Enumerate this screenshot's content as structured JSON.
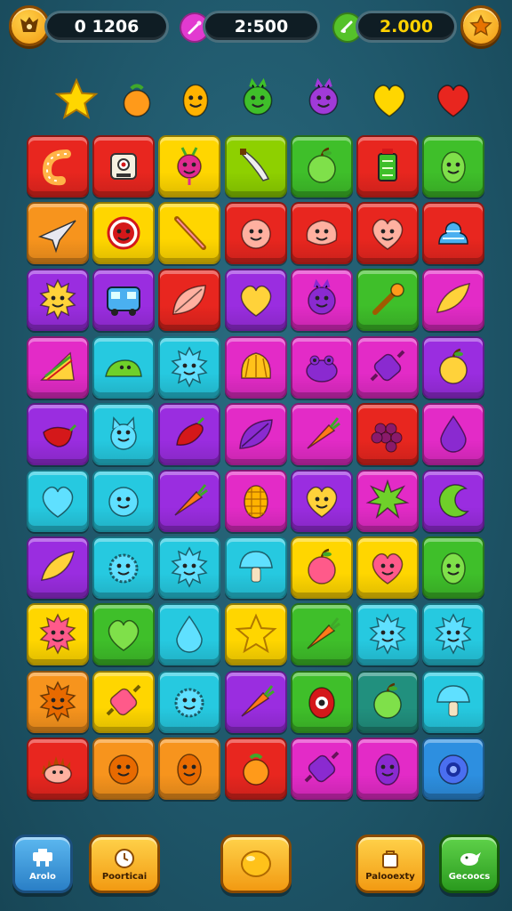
{
  "hud": {
    "left_button_icon": "badge-icon",
    "score": "0 1206",
    "moves": "2:500",
    "gold": "2.000",
    "moves_icon": "magic-wand-icon",
    "gold_icon": "check-icon",
    "right_button_icon": "star-icon"
  },
  "targets": [
    "starfish-icon",
    "orange-fruit-icon",
    "carrot-creature-icon",
    "green-monster-icon",
    "purple-creature-icon",
    "yellow-heart-icon",
    "red-heart-icon"
  ],
  "colors": {
    "red": "#e8261f",
    "orange": "#f7941d",
    "yellow": "#ffd600",
    "lime": "#8ed000",
    "green": "#3fbf2a",
    "purple": "#9a2de0",
    "magenta": "#e32bc7",
    "cyan": "#26c9e0",
    "blue": "#2d8fe0",
    "teal": "#21907e"
  },
  "board": [
    [
      {
        "c": "red",
        "i": "shrimp-icon"
      },
      {
        "c": "red",
        "i": "robot-icon"
      },
      {
        "c": "yellow",
        "i": "radish-icon"
      },
      {
        "c": "lime",
        "i": "knife-icon"
      },
      {
        "c": "green",
        "i": "apple-icon"
      },
      {
        "c": "red",
        "i": "lantern-icon"
      },
      {
        "c": "green",
        "i": "egg-icon"
      }
    ],
    [
      {
        "c": "orange",
        "i": "plane-icon"
      },
      {
        "c": "yellow",
        "i": "face-icon"
      },
      {
        "c": "yellow",
        "i": "stick-icon"
      },
      {
        "c": "red",
        "i": "smile-ball-icon"
      },
      {
        "c": "red",
        "i": "blob-icon"
      },
      {
        "c": "red",
        "i": "heart-face-icon"
      },
      {
        "c": "red",
        "i": "swirl-icon"
      }
    ],
    [
      {
        "c": "purple",
        "i": "sun-icon"
      },
      {
        "c": "purple",
        "i": "bus-icon"
      },
      {
        "c": "red",
        "i": "leaf-icon"
      },
      {
        "c": "purple",
        "i": "heart-icon"
      },
      {
        "c": "magenta",
        "i": "monster-icon"
      },
      {
        "c": "green",
        "i": "wrench-icon"
      },
      {
        "c": "magenta",
        "i": "banana-icon"
      }
    ],
    [
      {
        "c": "magenta",
        "i": "sandwich-icon"
      },
      {
        "c": "cyan",
        "i": "slug-icon"
      },
      {
        "c": "cyan",
        "i": "sun-icon"
      },
      {
        "c": "magenta",
        "i": "shell-icon"
      },
      {
        "c": "magenta",
        "i": "frog-icon"
      },
      {
        "c": "magenta",
        "i": "candy-icon"
      },
      {
        "c": "purple",
        "i": "apple-icon"
      }
    ],
    [
      {
        "c": "purple",
        "i": "chili-icon"
      },
      {
        "c": "cyan",
        "i": "cat-icon"
      },
      {
        "c": "purple",
        "i": "pepper-icon"
      },
      {
        "c": "magenta",
        "i": "leaf-icon"
      },
      {
        "c": "magenta",
        "i": "carrot-icon"
      },
      {
        "c": "red",
        "i": "grapes-icon"
      },
      {
        "c": "magenta",
        "i": "drop-icon"
      }
    ],
    [
      {
        "c": "cyan",
        "i": "heart-icon"
      },
      {
        "c": "cyan",
        "i": "smile-ball-icon"
      },
      {
        "c": "purple",
        "i": "carrot-icon"
      },
      {
        "c": "magenta",
        "i": "corn-icon"
      },
      {
        "c": "purple",
        "i": "heart-face-icon"
      },
      {
        "c": "magenta",
        "i": "splat-icon"
      },
      {
        "c": "purple",
        "i": "crescent-icon"
      }
    ],
    [
      {
        "c": "purple",
        "i": "banana-icon"
      },
      {
        "c": "cyan",
        "i": "fuzzy-icon"
      },
      {
        "c": "cyan",
        "i": "sun-icon"
      },
      {
        "c": "cyan",
        "i": "mushroom-icon"
      },
      {
        "c": "yellow",
        "i": "apple-icon"
      },
      {
        "c": "yellow",
        "i": "heart-face-icon"
      },
      {
        "c": "green",
        "i": "egg-icon"
      }
    ],
    [
      {
        "c": "yellow",
        "i": "sun-icon"
      },
      {
        "c": "green",
        "i": "heart-icon"
      },
      {
        "c": "cyan",
        "i": "drop-icon"
      },
      {
        "c": "yellow",
        "i": "star-icon"
      },
      {
        "c": "green",
        "i": "carrot-icon"
      },
      {
        "c": "cyan",
        "i": "sun-icon"
      },
      {
        "c": "cyan",
        "i": "sun-icon"
      }
    ],
    [
      {
        "c": "orange",
        "i": "sun-icon"
      },
      {
        "c": "yellow",
        "i": "candy-icon"
      },
      {
        "c": "cyan",
        "i": "fuzzy-icon"
      },
      {
        "c": "purple",
        "i": "carrot-icon"
      },
      {
        "c": "green",
        "i": "eye-icon"
      },
      {
        "c": "teal",
        "i": "apple-icon"
      },
      {
        "c": "cyan",
        "i": "mushroom-icon"
      }
    ],
    [
      {
        "c": "red",
        "i": "hedgehog-icon"
      },
      {
        "c": "orange",
        "i": "smile-ball-icon"
      },
      {
        "c": "orange",
        "i": "egg-icon"
      },
      {
        "c": "red",
        "i": "orange-fruit-icon"
      },
      {
        "c": "magenta",
        "i": "candy-icon"
      },
      {
        "c": "magenta",
        "i": "egg-icon"
      },
      {
        "c": "blue",
        "i": "ring-icon"
      }
    ]
  ],
  "bottom": {
    "btn1": {
      "label": "Arolo",
      "icon": "tool-icon"
    },
    "btn2": {
      "label": "Poorticai",
      "icon": "clock-icon"
    },
    "btn3": {
      "label": "",
      "icon": "ball-icon"
    },
    "btn4": {
      "label": "Palooexty",
      "icon": "bag-icon"
    },
    "btn5": {
      "label": "Gecoocs",
      "icon": "bird-icon"
    }
  }
}
